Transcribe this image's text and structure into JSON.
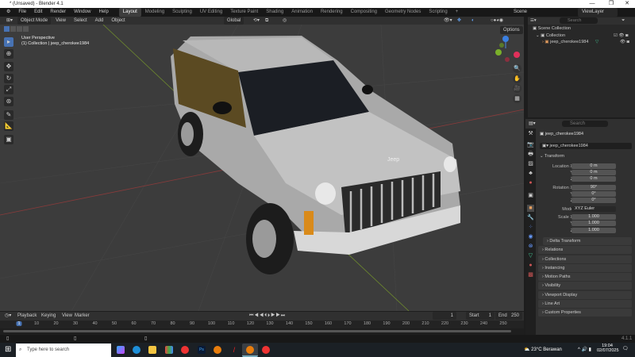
{
  "window": {
    "title": "* (Unsaved) - Blender 4.1",
    "minimize": "—",
    "maximize": "❐",
    "close": "✕"
  },
  "menu": {
    "items": [
      "File",
      "Edit",
      "Render",
      "Window",
      "Help"
    ]
  },
  "workspaces": [
    "Layout",
    "Modeling",
    "Sculpting",
    "UV Editing",
    "Texture Paint",
    "Shading",
    "Animation",
    "Rendering",
    "Compositing",
    "Geometry Nodes",
    "Scripting",
    "+"
  ],
  "active_workspace": "Layout",
  "scene": {
    "label": "Scene",
    "view_layer": "ViewLayer"
  },
  "viewport_header": {
    "mode": "Object Mode",
    "menus": [
      "View",
      "Select",
      "Add",
      "Object"
    ],
    "orientation": "Global",
    "options": "Options"
  },
  "viewport": {
    "view_name": "User Perspective",
    "collection_info": "(1) Collection | jeep_cherokee1984",
    "grille_badge": "Jeep"
  },
  "outliner": {
    "search_placeholder": "Search",
    "scene_collection": "Scene Collection",
    "collection": "Collection",
    "object": "jeep_cherokee1984"
  },
  "properties": {
    "search_placeholder": "Search",
    "object_name": "jeep_cherokee1984",
    "datablock": "jeep_cherokee1984",
    "transform_title": "Transform",
    "location": {
      "label": "Location X",
      "x": "0 m",
      "y": "0 m",
      "z": "0 m"
    },
    "rotation": {
      "label": "Rotation X",
      "x": "90°",
      "y": "0°",
      "z": "0°"
    },
    "mode": {
      "label": "Mode",
      "value": "XYZ Euler"
    },
    "scale": {
      "label": "Scale X",
      "x": "1.000",
      "y": "1.000",
      "z": "1.000"
    },
    "axis_y": "Y",
    "axis_z": "Z",
    "delta": "Delta Transform",
    "sections": [
      "Relations",
      "Collections",
      "Instancing",
      "Motion Paths",
      "Visibility",
      "Viewport Display",
      "Line Art",
      "Custom Properties"
    ]
  },
  "timeline": {
    "menus": [
      "Playback",
      "Keying",
      "View",
      "Marker"
    ],
    "current_frame": "1",
    "start_label": "Start",
    "start": "1",
    "end_label": "End",
    "end": "250",
    "ticks": [
      "1",
      "10",
      "20",
      "30",
      "40",
      "50",
      "60",
      "70",
      "80",
      "90",
      "100",
      "110",
      "120",
      "130",
      "140",
      "150",
      "160",
      "170",
      "180",
      "190",
      "200",
      "210",
      "220",
      "230",
      "240",
      "250"
    ]
  },
  "status": {
    "version": "4.1.1"
  },
  "taskbar": {
    "search_placeholder": "Type here to search",
    "weather": "23°C  Berawan",
    "time": "19:04",
    "date": "02/07/2025"
  }
}
